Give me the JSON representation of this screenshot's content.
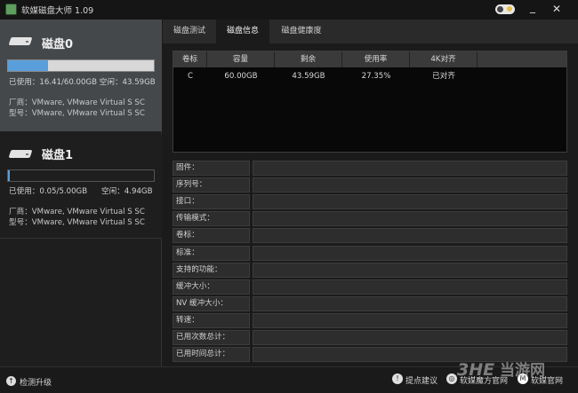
{
  "app": {
    "title": "软媒磁盘大师 1.09"
  },
  "disks": [
    {
      "name": "磁盘0",
      "used_fraction": 0.273,
      "usage_line": "已使用：16.41/60.00GB 空闲：43.59GB",
      "vendor_line": "厂商：VMware, VMware Virtual S SC",
      "model_line": "型号：VMware, VMware Virtual S SC"
    },
    {
      "name": "磁盘1",
      "used_fraction": 0.01,
      "usage_used": "已使用：0.05/5.00GB",
      "usage_free": "空闲：4.94GB",
      "vendor_line": "厂商：VMware, VMware Virtual S SC",
      "model_line": "型号：VMware, VMware Virtual S SC"
    }
  ],
  "tabs": [
    "磁盘测试",
    "磁盘信息",
    "磁盘健康度"
  ],
  "active_tab": 1,
  "partition_table": {
    "headers": [
      "卷标",
      "容量",
      "剩余",
      "使用率",
      "4K对齐"
    ],
    "rows": [
      [
        "C",
        "60.00GB",
        "43.59GB",
        "27.35%",
        "已对齐"
      ]
    ]
  },
  "info_labels": [
    "固件：",
    "序列号：",
    "接口：",
    "传输模式：",
    "卷标：",
    "标准：",
    "支持的功能：",
    "缓冲大小：",
    "NV 缓冲大小：",
    "转速：",
    "已用次数总计：",
    "已用时间总计："
  ],
  "footer": {
    "check_update": "检测升级",
    "feedback": "提点建议",
    "magic_cube_site": "软媒魔方官网",
    "official_site": "软媒官网"
  },
  "watermark": {
    "text": "3HE当游网"
  },
  "colors": {
    "accent": "#5a9fdc",
    "background": "#1b1b1b",
    "selected_disk_bg": "#45484b"
  }
}
